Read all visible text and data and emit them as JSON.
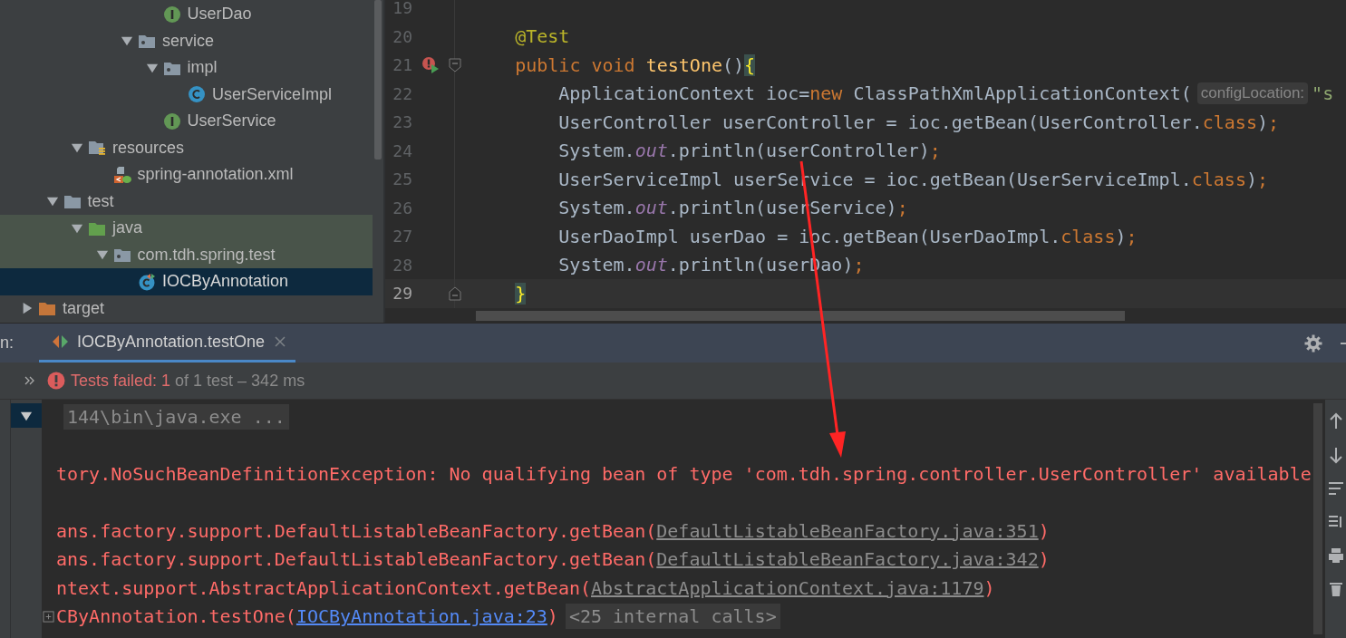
{
  "project_tree": [
    {
      "children": [
        {
          "children": [
            {
              "children": [
                {
                  "children": [
                    {
                      "children": [
                        {
                          "label": "UserDao",
                          "kind": "interface",
                          "selected": false,
                          "highlighted": false
                        }
                      ]
                    },
                    {
                      "label": "service",
                      "kind": "package",
                      "expanded": true,
                      "selected": false,
                      "highlighted": false,
                      "children": [
                        {
                          "label": "impl",
                          "kind": "package",
                          "expanded": true,
                          "selected": false,
                          "highlighted": false,
                          "children": [
                            {
                              "label": "UserServiceImpl",
                              "kind": "class",
                              "selected": false,
                              "highlighted": false
                            }
                          ]
                        },
                        {
                          "label": "UserService",
                          "kind": "interface",
                          "selected": false,
                          "highlighted": false
                        }
                      ]
                    }
                  ]
                }
              ]
            },
            {
              "label": "resources",
              "kind": "resources",
              "expanded": true,
              "selected": false,
              "highlighted": false,
              "children": [
                {
                  "label": "spring-annotation.xml",
                  "kind": "xml",
                  "selected": false,
                  "highlighted": false
                }
              ]
            }
          ]
        },
        {
          "label": "test",
          "kind": "folder",
          "expanded": true,
          "selected": false,
          "highlighted": false,
          "children": [
            {
              "label": "java",
              "kind": "test-root",
              "expanded": true,
              "selected": false,
              "highlighted": true,
              "children": [
                {
                  "label": "com.tdh.spring.test",
                  "kind": "package",
                  "expanded": true,
                  "selected": false,
                  "highlighted": true,
                  "children": [
                    {
                      "label": "IOCByAnnotation",
                      "kind": "test-class",
                      "selected": true,
                      "highlighted": false
                    }
                  ]
                }
              ]
            }
          ]
        }
      ]
    },
    {
      "label": "target",
      "kind": "excluded",
      "expanded": false,
      "selected": false,
      "highlighted": false
    }
  ],
  "editor": {
    "lines": [
      {
        "number": "19",
        "current": false,
        "run_error": false,
        "fold_start": false,
        "fold_end": false
      },
      {
        "number": "20",
        "current": false,
        "run_error": false,
        "fold_start": false,
        "fold_end": false,
        "tokens": [
          {
            "text": "    @Test",
            "kind": "annotation"
          }
        ]
      },
      {
        "number": "21",
        "current": false,
        "run_error": true,
        "fold_start": true,
        "fold_end": false,
        "tokens": [
          {
            "text": "    public void ",
            "kind": "keyword"
          },
          {
            "text": "testOne",
            "kind": "method"
          },
          {
            "text": "()",
            "kind": "plain"
          },
          {
            "text": "{",
            "kind": "brace"
          }
        ]
      },
      {
        "number": "22",
        "current": false,
        "run_error": false,
        "fold_start": false,
        "fold_end": false,
        "tokens": [
          {
            "text": "        ApplicationContext ioc=",
            "kind": "plain"
          },
          {
            "text": "new",
            "kind": "keyword"
          },
          {
            "text": " ClassPathXmlApplicationContext(",
            "kind": "plain"
          },
          {
            "text": "configLocation:",
            "kind": "hint"
          },
          {
            "text": "\"s",
            "kind": "string"
          }
        ]
      },
      {
        "number": "23",
        "current": false,
        "run_error": false,
        "fold_start": false,
        "fold_end": false,
        "tokens": [
          {
            "text": "        UserController userController = ioc.getBean(UserController.",
            "kind": "plain"
          },
          {
            "text": "class",
            "kind": "keyword"
          },
          {
            "text": ")",
            "kind": "plain"
          },
          {
            "text": ";",
            "kind": "keyword"
          }
        ]
      },
      {
        "number": "24",
        "current": false,
        "run_error": false,
        "fold_start": false,
        "fold_end": false,
        "tokens": [
          {
            "text": "        System.",
            "kind": "plain"
          },
          {
            "text": "out",
            "kind": "static"
          },
          {
            "text": ".println(userController)",
            "kind": "plain"
          },
          {
            "text": ";",
            "kind": "keyword"
          }
        ]
      },
      {
        "number": "25",
        "current": false,
        "run_error": false,
        "fold_start": false,
        "fold_end": false,
        "tokens": [
          {
            "text": "        UserServiceImpl userService = ioc.getBean(UserServiceImpl.",
            "kind": "plain"
          },
          {
            "text": "class",
            "kind": "keyword"
          },
          {
            "text": ")",
            "kind": "plain"
          },
          {
            "text": ";",
            "kind": "keyword"
          }
        ]
      },
      {
        "number": "26",
        "current": false,
        "run_error": false,
        "fold_start": false,
        "fold_end": false,
        "tokens": [
          {
            "text": "        System.",
            "kind": "plain"
          },
          {
            "text": "out",
            "kind": "static"
          },
          {
            "text": ".println(userService)",
            "kind": "plain"
          },
          {
            "text": ";",
            "kind": "keyword"
          }
        ]
      },
      {
        "number": "27",
        "current": false,
        "run_error": false,
        "fold_start": false,
        "fold_end": false,
        "tokens": [
          {
            "text": "        UserDaoImpl userDao = ioc.getBean(UserDaoImpl.",
            "kind": "plain"
          },
          {
            "text": "class",
            "kind": "keyword"
          },
          {
            "text": ")",
            "kind": "plain"
          },
          {
            "text": ";",
            "kind": "keyword"
          }
        ]
      },
      {
        "number": "28",
        "current": false,
        "run_error": false,
        "fold_start": false,
        "fold_end": false,
        "tokens": [
          {
            "text": "        System.",
            "kind": "plain"
          },
          {
            "text": "out",
            "kind": "static"
          },
          {
            "text": ".println(userDao)",
            "kind": "plain"
          },
          {
            "text": ";",
            "kind": "keyword"
          }
        ]
      },
      {
        "number": "29",
        "current": true,
        "run_error": false,
        "fold_start": false,
        "fold_end": true,
        "tokens": [
          {
            "text": "    }",
            "kind": "brace"
          }
        ]
      }
    ]
  },
  "run_window": {
    "title": "n:",
    "tabs": [
      {
        "label": "IOCByAnnotation.testOne",
        "selected": true,
        "closable": true
      }
    ]
  },
  "test_summary": {
    "failed": true,
    "label": "Tests failed: 1",
    "detail": "of 1 test – 342 ms"
  },
  "results_tree": {
    "expanded": true,
    "selected": true
  },
  "console": [
    {
      "kind": "text",
      "expandable": false,
      "segments": [
        {
          "text": "144\\bin\\java.exe ...",
          "kind": "folded"
        }
      ]
    },
    {
      "kind": "blank"
    },
    {
      "kind": "text",
      "expandable": false,
      "segments": [
        {
          "text": "tory.NoSuchBeanDefinitionException: No qualifying bean of type 'com.tdh.spring.controller.UserController' available",
          "kind": "error"
        }
      ]
    },
    {
      "kind": "blank"
    },
    {
      "kind": "text",
      "expandable": false,
      "segments": [
        {
          "text": "ans.factory.support.DefaultListableBeanFactory.getBean(",
          "kind": "error"
        },
        {
          "text": "DefaultListableBeanFactory.java:351",
          "kind": "link"
        },
        {
          "text": ")",
          "kind": "error"
        }
      ]
    },
    {
      "kind": "text",
      "expandable": false,
      "segments": [
        {
          "text": "ans.factory.support.DefaultListableBeanFactory.getBean(",
          "kind": "error"
        },
        {
          "text": "DefaultListableBeanFactory.java:342",
          "kind": "link"
        },
        {
          "text": ")",
          "kind": "error"
        }
      ]
    },
    {
      "kind": "text",
      "expandable": false,
      "segments": [
        {
          "text": "ntext.support.AbstractApplicationContext.getBean(",
          "kind": "error"
        },
        {
          "text": "AbstractApplicationContext.java:1179",
          "kind": "link"
        },
        {
          "text": ")",
          "kind": "error"
        }
      ]
    },
    {
      "kind": "text",
      "expandable": true,
      "segments": [
        {
          "text": "CByAnnotation.testOne(",
          "kind": "error"
        },
        {
          "text": "IOCByAnnotation.java:23",
          "kind": "source-link"
        },
        {
          "text": ")",
          "kind": "error"
        },
        {
          "text": "<25 internal calls>",
          "kind": "folded"
        }
      ]
    }
  ],
  "overlay": {
    "kind": "arrow"
  }
}
